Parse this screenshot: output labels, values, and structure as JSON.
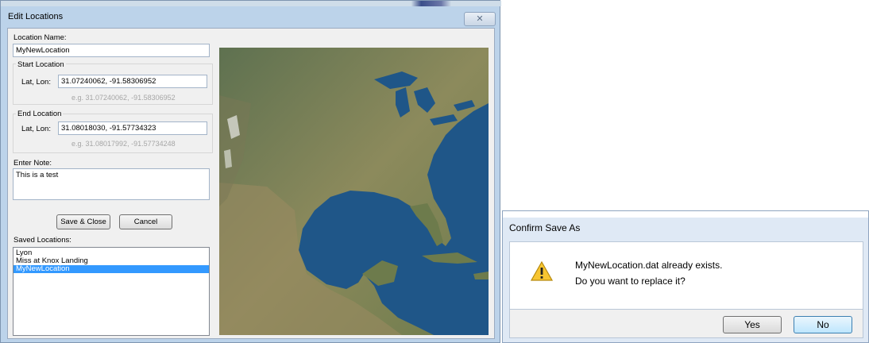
{
  "edit_window": {
    "title": "Edit Locations",
    "close_glyph": "✕",
    "location_name_label": "Location Name:",
    "location_name_value": "MyNewLocation",
    "start": {
      "group_label": "Start Location",
      "latlon_label": "Lat, Lon:",
      "value": "31.07240062, -91.58306952",
      "example": "e.g. 31.07240062, -91.58306952"
    },
    "end": {
      "group_label": "End Location",
      "latlon_label": "Lat, Lon:",
      "value": "31.08018030, -91.57734323",
      "example": "e.g. 31.08017992, -91.57734248"
    },
    "note_label": "Enter Note:",
    "note_value": "This is a test",
    "save_close_label": "Save & Close",
    "cancel_label": "Cancel",
    "saved_locations_label": "Saved Locations:",
    "saved_locations": [
      {
        "label": "Lyon",
        "selected": false
      },
      {
        "label": "Miss at Knox Landing",
        "selected": false
      },
      {
        "label": "MyNewLocation",
        "selected": true
      }
    ],
    "map_icon": "satellite-map-north-america"
  },
  "confirm_dialog": {
    "title": "Confirm Save As",
    "icon": "warning-icon",
    "message_line1": "MyNewLocation.dat already exists.",
    "message_line2": "Do you want to replace it?",
    "yes_label": "Yes",
    "no_label": "No"
  },
  "colors": {
    "selection": "#3399ff",
    "window_frame": "#bcd3ea",
    "ocean": "#1f5688",
    "land": "#6f7a4a"
  }
}
